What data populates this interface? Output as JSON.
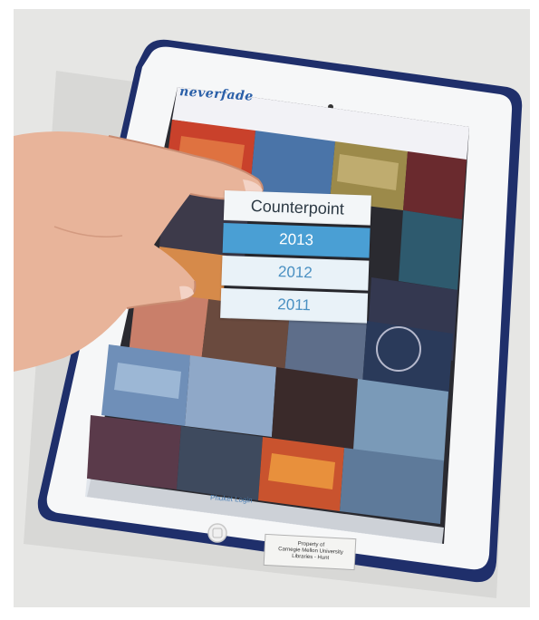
{
  "photo": {
    "subject": "Hand tapping a menu on a white iPad showing a music festival photo grid"
  },
  "app": {
    "brand": "neverfade",
    "menu": {
      "title": "Counterpoint",
      "years": [
        "2013",
        "2012",
        "2011"
      ],
      "selected": "2013"
    },
    "footer_link": "Phuket Login"
  },
  "device_tag": {
    "line1": "Property of",
    "line2": "Carnegie Mellon University",
    "line3": "Libraries - Hunt"
  },
  "colors": {
    "accent": "#4a9fd4",
    "brand": "#2a5fa8",
    "case": "#1f2f6b"
  }
}
